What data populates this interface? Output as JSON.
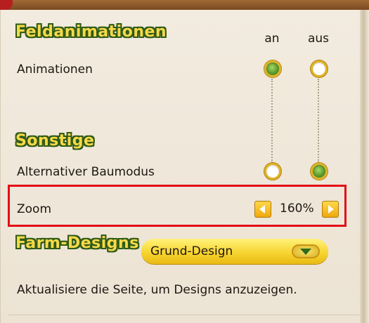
{
  "sections": {
    "field_animations": {
      "title": "Feldanimationen",
      "col_on": "an",
      "col_off": "aus",
      "rows": [
        {
          "label": "Animationen",
          "value": "an"
        }
      ]
    },
    "other": {
      "title": "Sonstige",
      "rows": [
        {
          "label": "Alternativer Baumodus",
          "value": "aus"
        }
      ],
      "zoom": {
        "label": "Zoom",
        "value": "160%"
      }
    },
    "farm_designs": {
      "title": "Farm-Designs",
      "selected": "Grund-Design",
      "note": "Aktualisiere die Seite, um Designs anzuzeigen."
    }
  },
  "colors": {
    "title_fill": "#f5d94a",
    "title_outline": "#2f5a16",
    "radio_on": "#5a9a2a",
    "highlight": "#e30b16",
    "dropdown": "#f6d22c"
  },
  "icons": [
    "arrow-left-icon",
    "arrow-right-icon",
    "dropdown-arrow-icon"
  ]
}
